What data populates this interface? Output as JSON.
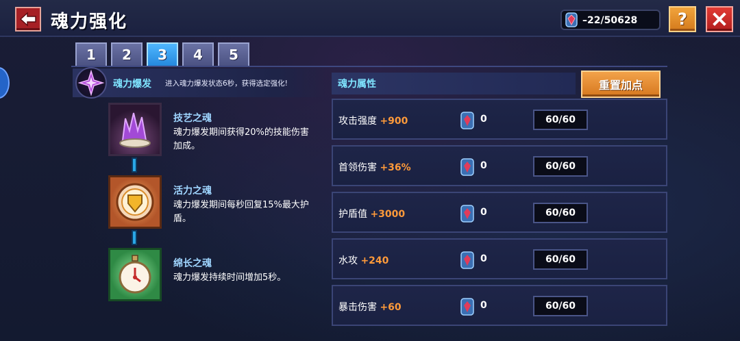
{
  "header": {
    "title": "魂力强化",
    "currency_value": "–22/50628"
  },
  "tabs": [
    {
      "label": "1"
    },
    {
      "label": "2"
    },
    {
      "label": "3",
      "active": true
    },
    {
      "label": "4"
    },
    {
      "label": "5"
    }
  ],
  "burst": {
    "title": "魂力爆发",
    "description": "进入魂力爆发状态6秒，获得选定强化!"
  },
  "souls": [
    {
      "name": "技艺之魂",
      "description": "魂力爆发期间获得20%的技能伤害加成。",
      "icon": "purple-crystal-icon"
    },
    {
      "name": "活力之魂",
      "description": "魂力爆发期间每秒回复15%最大护盾。",
      "icon": "golden-shield-icon"
    },
    {
      "name": "绵长之魂",
      "description": "魂力爆发持续时间增加5秒。",
      "icon": "stopwatch-icon"
    }
  ],
  "attributes": {
    "title": "魂力属性",
    "reset_label": "重置加点",
    "rows": [
      {
        "label": "攻击强度",
        "bonus": "+900",
        "cost": "0",
        "level": "60/60"
      },
      {
        "label": "首领伤害",
        "bonus": "+36%",
        "cost": "0",
        "level": "60/60"
      },
      {
        "label": "护盾值",
        "bonus": "+3000",
        "cost": "0",
        "level": "60/60"
      },
      {
        "label": "水攻",
        "bonus": "+240",
        "cost": "0",
        "level": "60/60"
      },
      {
        "label": "暴击伤害",
        "bonus": "+60",
        "cost": "0",
        "level": "60/60"
      }
    ]
  },
  "colors": {
    "accent_cyan": "#7fe4ff",
    "bonus_orange": "#ff9a3a",
    "button_orange": "#e58c32",
    "close_red": "#c92a27"
  }
}
